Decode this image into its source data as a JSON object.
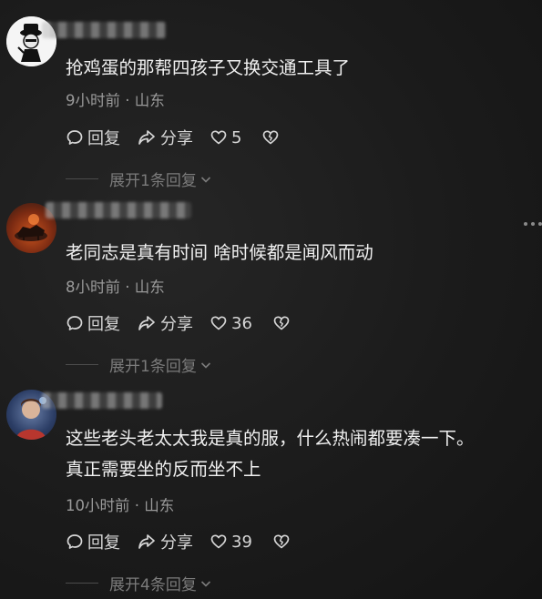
{
  "comments": [
    {
      "text_lines": [
        "抢鸡蛋的那帮四孩子又换交通工具了"
      ],
      "meta": "9小时前 · 山东",
      "reply_label": "回复",
      "share_label": "分享",
      "like_count": "5",
      "expand_label": "展开1条回复"
    },
    {
      "text_lines": [
        "老同志是真有时间 啥时候都是闻风而动"
      ],
      "meta": "8小时前 · 山东",
      "reply_label": "回复",
      "share_label": "分享",
      "like_count": "36",
      "expand_label": "展开1条回复"
    },
    {
      "text_lines": [
        "这些老头老太太我是真的服，什么热闹都要凑一下。",
        "真正需要坐的反而坐不上"
      ],
      "meta": "10小时前 · 山东",
      "reply_label": "回复",
      "share_label": "分享",
      "like_count": "39",
      "expand_label": "展开4条回复"
    }
  ],
  "colors": {
    "background": "#1b1b1b",
    "text": "#f0f0f0",
    "meta": "#9a9a9a",
    "expand": "#7b7b7b"
  },
  "icons": [
    "comment-icon",
    "share-icon",
    "heart-icon",
    "broken-heart-icon",
    "chevron-down-icon",
    "more-icon"
  ]
}
